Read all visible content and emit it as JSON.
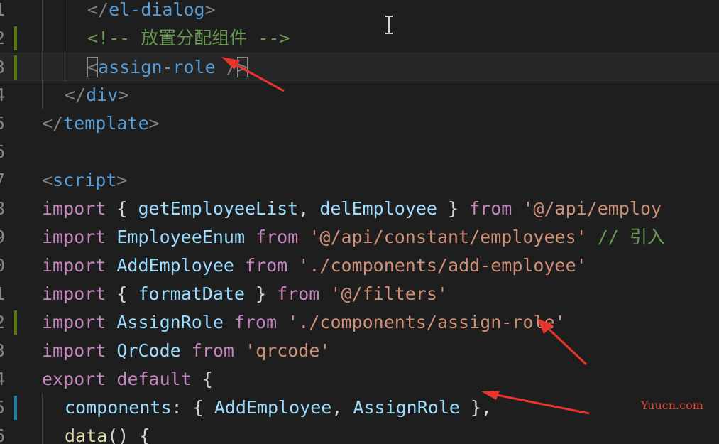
{
  "editor": {
    "lines": [
      {
        "no": "1",
        "gutter": "none",
        "indent": 2,
        "tokens": [
          {
            "t": "</",
            "c": "tagb"
          },
          {
            "t": "el-dialog",
            "c": "tag"
          },
          {
            "t": ">",
            "c": "tagb"
          }
        ]
      },
      {
        "no": "2",
        "gutter": "green",
        "indent": 2,
        "tokens": [
          {
            "t": "<!-- 放置分配组件 -->",
            "c": "cmt"
          }
        ]
      },
      {
        "no": "3",
        "gutter": "green",
        "indent": 2,
        "current": true,
        "tokens": [
          {
            "t": "<",
            "c": "tagb",
            "box": true
          },
          {
            "t": "assign-role",
            "c": "tag"
          },
          {
            "t": " ",
            "c": "punc"
          },
          {
            "t": "/",
            "c": "tagb"
          },
          {
            "t": ">",
            "c": "tagb",
            "box": true
          }
        ]
      },
      {
        "no": "4",
        "gutter": "none",
        "indent": 1,
        "tokens": [
          {
            "t": "</",
            "c": "tagb"
          },
          {
            "t": "div",
            "c": "tag"
          },
          {
            "t": ">",
            "c": "tagb"
          }
        ]
      },
      {
        "no": "5",
        "gutter": "none",
        "indent": 0,
        "tokens": [
          {
            "t": "</",
            "c": "tagb"
          },
          {
            "t": "template",
            "c": "tag"
          },
          {
            "t": ">",
            "c": "tagb"
          }
        ]
      },
      {
        "no": "6",
        "gutter": "none",
        "indent": 0,
        "tokens": []
      },
      {
        "no": "7",
        "gutter": "none",
        "indent": 0,
        "tokens": [
          {
            "t": "<",
            "c": "tagb"
          },
          {
            "t": "script",
            "c": "tag"
          },
          {
            "t": ">",
            "c": "tagb"
          }
        ]
      },
      {
        "no": "8",
        "gutter": "none",
        "indent": 0,
        "tokens": [
          {
            "t": "import",
            "c": "kw"
          },
          {
            "t": " { ",
            "c": "punc"
          },
          {
            "t": "getEmployeeList",
            "c": "var"
          },
          {
            "t": ", ",
            "c": "punc"
          },
          {
            "t": "delEmployee",
            "c": "var"
          },
          {
            "t": " } ",
            "c": "punc"
          },
          {
            "t": "from",
            "c": "kw"
          },
          {
            "t": " ",
            "c": "punc"
          },
          {
            "t": "'@/api/employ",
            "c": "str"
          }
        ]
      },
      {
        "no": "9",
        "gutter": "none",
        "indent": 0,
        "tokens": [
          {
            "t": "import",
            "c": "kw"
          },
          {
            "t": " ",
            "c": "punc"
          },
          {
            "t": "EmployeeEnum",
            "c": "var"
          },
          {
            "t": " ",
            "c": "punc"
          },
          {
            "t": "from",
            "c": "kw"
          },
          {
            "t": " ",
            "c": "punc"
          },
          {
            "t": "'@/api/constant/employees'",
            "c": "str"
          },
          {
            "t": " // 引入",
            "c": "cmt"
          }
        ]
      },
      {
        "no": "0",
        "gutter": "none",
        "indent": 0,
        "tokens": [
          {
            "t": "import",
            "c": "kw"
          },
          {
            "t": " ",
            "c": "punc"
          },
          {
            "t": "AddEmployee",
            "c": "var"
          },
          {
            "t": " ",
            "c": "punc"
          },
          {
            "t": "from",
            "c": "kw"
          },
          {
            "t": " ",
            "c": "punc"
          },
          {
            "t": "'./components/add-employee'",
            "c": "str"
          }
        ]
      },
      {
        "no": "1",
        "gutter": "none",
        "indent": 0,
        "tokens": [
          {
            "t": "import",
            "c": "kw"
          },
          {
            "t": " { ",
            "c": "punc"
          },
          {
            "t": "formatDate",
            "c": "var"
          },
          {
            "t": " } ",
            "c": "punc"
          },
          {
            "t": "from",
            "c": "kw"
          },
          {
            "t": " ",
            "c": "punc"
          },
          {
            "t": "'@/filters'",
            "c": "str"
          }
        ]
      },
      {
        "no": "2",
        "gutter": "green",
        "indent": 0,
        "tokens": [
          {
            "t": "import",
            "c": "kw"
          },
          {
            "t": " ",
            "c": "punc"
          },
          {
            "t": "AssignRole",
            "c": "var"
          },
          {
            "t": " ",
            "c": "punc"
          },
          {
            "t": "from",
            "c": "kw"
          },
          {
            "t": " ",
            "c": "punc"
          },
          {
            "t": "'./components/assign-role'",
            "c": "str"
          }
        ]
      },
      {
        "no": "3",
        "gutter": "none",
        "indent": 0,
        "tokens": [
          {
            "t": "import",
            "c": "kw"
          },
          {
            "t": " ",
            "c": "punc"
          },
          {
            "t": "QrCode",
            "c": "var"
          },
          {
            "t": " ",
            "c": "punc"
          },
          {
            "t": "from",
            "c": "kw"
          },
          {
            "t": " ",
            "c": "punc"
          },
          {
            "t": "'qrcode'",
            "c": "str"
          }
        ]
      },
      {
        "no": "4",
        "gutter": "none",
        "indent": 0,
        "tokens": [
          {
            "t": "export",
            "c": "kw"
          },
          {
            "t": " ",
            "c": "punc"
          },
          {
            "t": "default",
            "c": "kw"
          },
          {
            "t": " {",
            "c": "punc"
          }
        ]
      },
      {
        "no": "5",
        "gutter": "blue",
        "indent": 1,
        "tokens": [
          {
            "t": "components",
            "c": "var"
          },
          {
            "t": ": { ",
            "c": "punc"
          },
          {
            "t": "AddEmployee",
            "c": "var"
          },
          {
            "t": ", ",
            "c": "punc"
          },
          {
            "t": "AssignRole",
            "c": "var"
          },
          {
            "t": " },",
            "c": "punc"
          }
        ]
      },
      {
        "no": "6",
        "gutter": "none",
        "indent": 1,
        "tokens": [
          {
            "t": "data",
            "c": "fn"
          },
          {
            "t": "() {",
            "c": "punc"
          }
        ]
      }
    ]
  },
  "watermark": "Yuucn.com",
  "colors": {
    "background": "#1e1e1e",
    "annotation_arrow": "#e8342a",
    "gutter_added": "#587c0c",
    "gutter_modified": "#1b81a8"
  }
}
